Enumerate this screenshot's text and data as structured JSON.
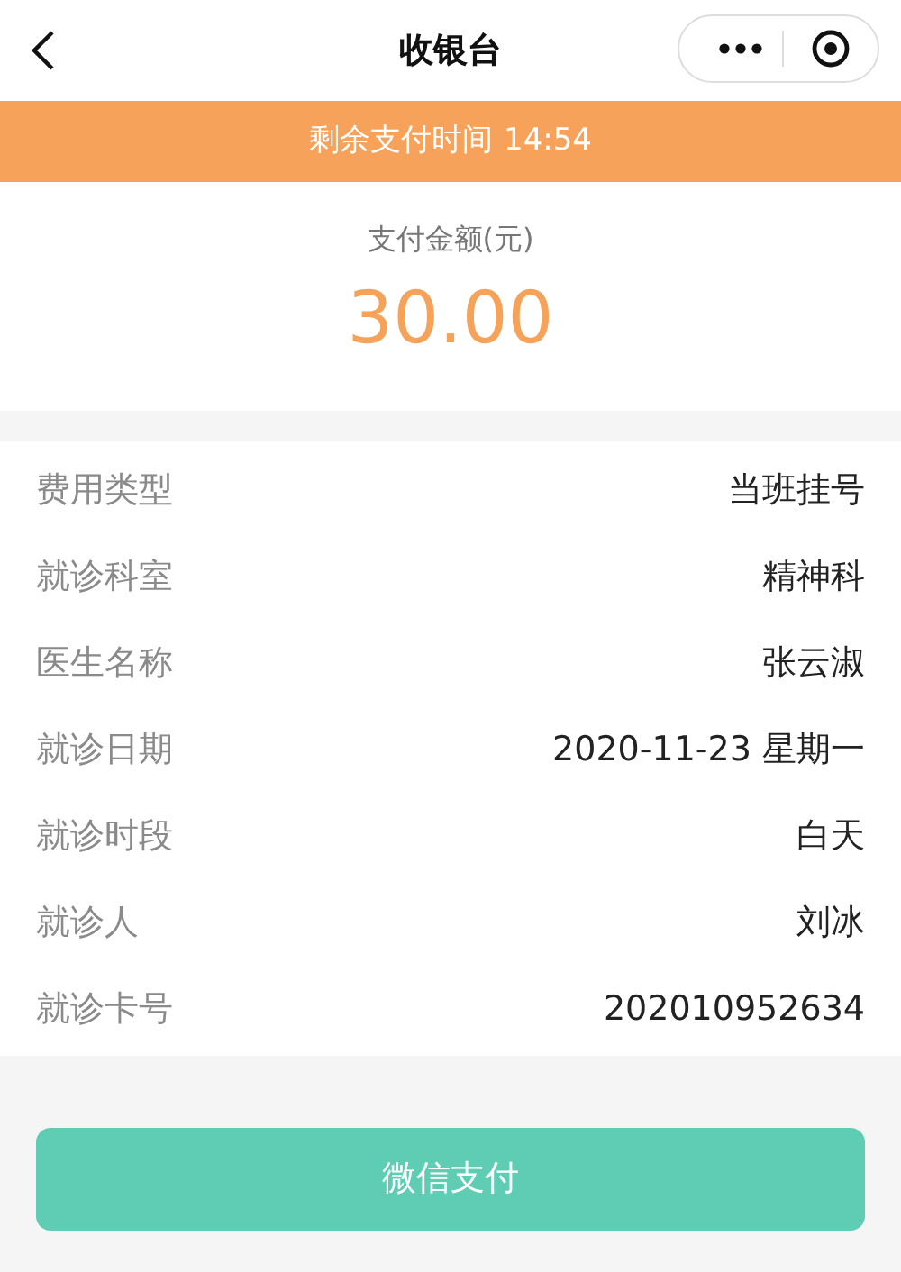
{
  "nav": {
    "title": "收银台"
  },
  "countdown": {
    "label": "剩余支付时间",
    "time": "14:54"
  },
  "amount": {
    "label": "支付金额(元)",
    "value": "30.00"
  },
  "details": [
    {
      "label": "费用类型",
      "value": "当班挂号"
    },
    {
      "label": "就诊科室",
      "value": "精神科"
    },
    {
      "label": "医生名称",
      "value": "张云淑"
    },
    {
      "label": "就诊日期",
      "value": "2020-11-23 星期一"
    },
    {
      "label": "就诊时段",
      "value": "白天"
    },
    {
      "label": "就诊人",
      "value": "刘冰"
    },
    {
      "label": "就诊卡号",
      "value": "202010952634"
    }
  ],
  "pay_button": {
    "label": "微信支付"
  }
}
